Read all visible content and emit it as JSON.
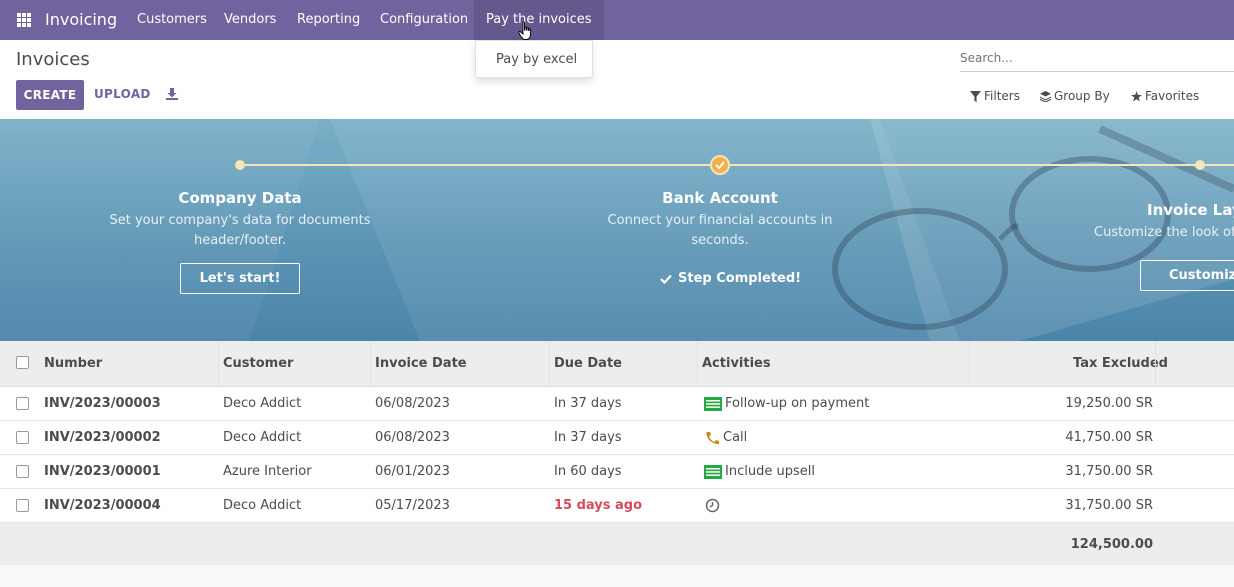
{
  "navbar": {
    "brand": "Invoicing",
    "menu": [
      "Customers",
      "Vendors",
      "Reporting",
      "Configuration",
      "Pay the invoices"
    ],
    "dropdown_item": "Pay by excel"
  },
  "control_panel": {
    "title": "Invoices",
    "create_label": "CREATE",
    "upload_label": "UPLOAD",
    "search_placeholder": "Search...",
    "filters_label": "Filters",
    "groupby_label": "Group By",
    "favorites_label": "Favorites"
  },
  "onboarding": {
    "steps": [
      {
        "title": "Company Data",
        "desc_line1": "Set your company's data for documents",
        "desc_line2": "header/footer.",
        "button": "Let's start!"
      },
      {
        "title": "Bank Account",
        "desc_line1": "Connect your financial accounts in",
        "desc_line2": "seconds.",
        "status": "Step Completed!"
      },
      {
        "title": "Invoice Layo",
        "desc_line1": "Customize the look of yo",
        "button": "Customize"
      }
    ],
    "colors": {
      "accent": "#f0b247",
      "line": "#f5e6b8"
    }
  },
  "table": {
    "headers": {
      "number": "Number",
      "customer": "Customer",
      "invoice_date": "Invoice Date",
      "due_date": "Due Date",
      "activities": "Activities",
      "tax_excluded": "Tax Excluded"
    },
    "rows": [
      {
        "number": "INV/2023/00003",
        "customer": "Deco Addict",
        "invoice_date": "06/08/2023",
        "due_date": "In 37 days",
        "activity_icon": "money-icon",
        "activity": "Follow-up on payment",
        "tax_excluded": "19,250.00 SR"
      },
      {
        "number": "INV/2023/00002",
        "customer": "Deco Addict",
        "invoice_date": "06/08/2023",
        "due_date": "In 37 days",
        "activity_icon": "phone-icon",
        "activity": "Call",
        "tax_excluded": "41,750.00 SR"
      },
      {
        "number": "INV/2023/00001",
        "customer": "Azure Interior",
        "invoice_date": "06/01/2023",
        "due_date": "In 60 days",
        "activity_icon": "money-icon",
        "activity": "Include upsell",
        "tax_excluded": "31,750.00 SR"
      },
      {
        "number": "INV/2023/00004",
        "customer": "Deco Addict",
        "invoice_date": "05/17/2023",
        "due_date": "15 days ago",
        "activity_icon": "clock-icon",
        "activity": "",
        "tax_excluded": "31,750.00 SR"
      }
    ],
    "total": "124,500.00"
  },
  "colors": {
    "brand": "#71639e",
    "overdue": "#d44c59",
    "money_icon": "#28a745",
    "phone_icon": "#c98a1a"
  }
}
